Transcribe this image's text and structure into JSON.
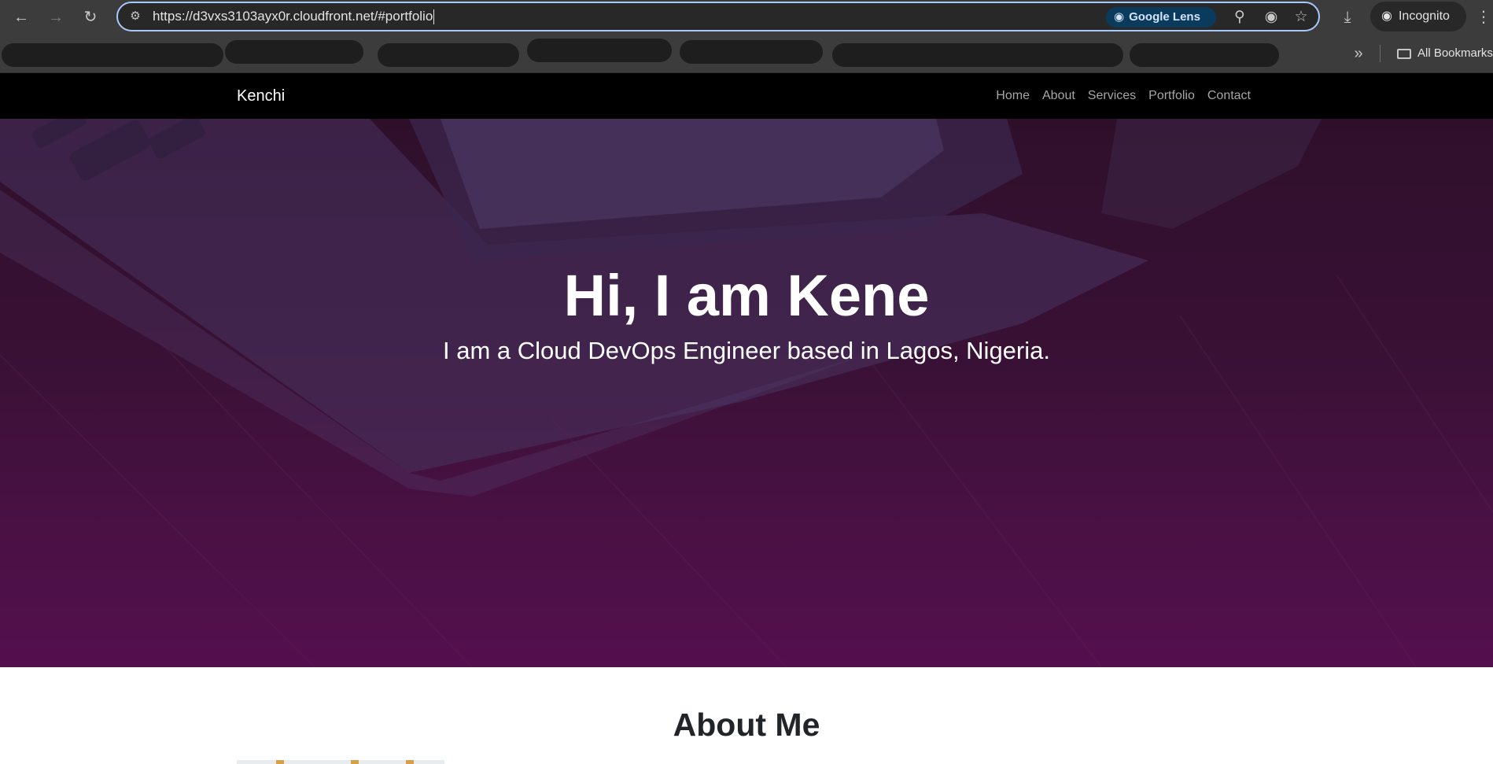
{
  "browser": {
    "url": "https://d3vxs3103ayx0r.cloudfront.net/#portfolio",
    "lens_label": "Google Lens",
    "incognito_label": "Incognito",
    "all_bookmarks_label": "All Bookmarks",
    "icons": {
      "back": "back-arrow-icon",
      "forward": "forward-arrow-icon",
      "reload": "reload-icon",
      "site_info": "site-info-icon",
      "lens": "google-lens-icon",
      "zoom": "zoom-icon",
      "eye_off": "tracking-protection-icon",
      "star": "bookmark-star-icon",
      "download": "download-icon",
      "incognito": "incognito-icon",
      "menu": "kebab-menu-icon",
      "chevron": "double-chevron-icon",
      "folder": "folder-icon"
    }
  },
  "site": {
    "brand": "Kenchi",
    "nav": [
      {
        "label": "Home"
      },
      {
        "label": "About"
      },
      {
        "label": "Services"
      },
      {
        "label": "Portfolio"
      },
      {
        "label": "Contact"
      }
    ]
  },
  "hero": {
    "title": "Hi, I am Kene",
    "subtitle": "I am a Cloud DevOps Engineer based in Lagos, Nigeria."
  },
  "about": {
    "heading": "About Me"
  },
  "colors": {
    "chrome_bg": "#3c3c3c",
    "omnibox_border": "#a8c7fa",
    "navbar_bg": "#000000",
    "hero_top": "#2a0f26",
    "hero_bottom": "#5c0f55"
  }
}
